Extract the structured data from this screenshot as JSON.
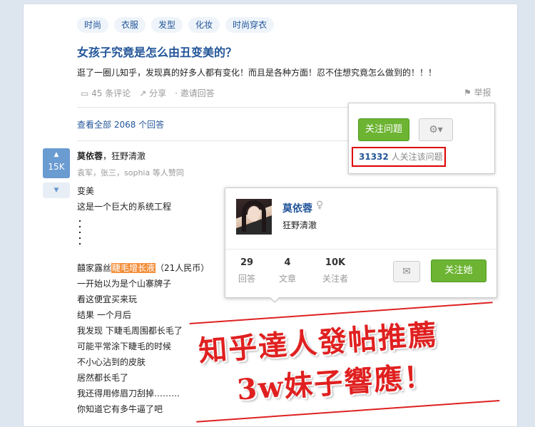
{
  "topics": [
    "时尚",
    "衣服",
    "发型",
    "化妆",
    "时尚穿衣"
  ],
  "question": {
    "title": "女孩子究竟是怎么由丑变美的？",
    "detail": "逛了一圈儿知乎，发现真的好多人都有变化！而且是各种方面！忍不住想究竟怎么做到的！！！",
    "comments": "45 条评论",
    "share": "分享",
    "invite": "邀请回答",
    "report": "举报",
    "view_all": "查看全部 2068 个回答"
  },
  "follow_panel": {
    "follow_label": "关注问题",
    "gear_glyph": "⚙▾",
    "follower_count": "31332",
    "follower_text": "人关注该问题"
  },
  "answer": {
    "votes": "15K",
    "up_arrow": "▲",
    "down_arrow": "▼",
    "author_name": "莫依蓉",
    "author_bio": "，狂野清澈",
    "voters": "袁军，张三，sophia 等人赞同",
    "lines": [
      "变美",
      "这是一个巨大的系统工程"
    ],
    "product_prefix": "囍家露丝",
    "product_highlight": "睫毛增长液",
    "product_suffix": "（21人民币）",
    "lines2": [
      "一开始以为是个山寨牌子",
      "看这便宜买来玩",
      "结果 一个月后",
      "我发现 下睫毛周围都长毛了",
      "可能平常涂下睫毛的时候",
      "不小心沾到的皮肤",
      "居然都长毛了",
      "我还得用修眉刀刮掉………",
      "你知道它有多牛逼了吧"
    ]
  },
  "profile": {
    "name": "莫依蓉",
    "gender_glyph": "♀",
    "bio": "狂野清澈",
    "answers_num": "29",
    "answers_label": "回答",
    "articles_num": "4",
    "articles_label": "文章",
    "followers_num": "10K",
    "followers_label": "关注者",
    "message_glyph": "✉",
    "follow_label": "关注她"
  },
  "banner": {
    "line1": "知乎達人發帖推薦",
    "line2": "3w妹子響應！"
  },
  "colors": {
    "link": "#225599",
    "green": "#6cb432",
    "red_border": "#dd0000",
    "highlight": "#f48f3a"
  }
}
